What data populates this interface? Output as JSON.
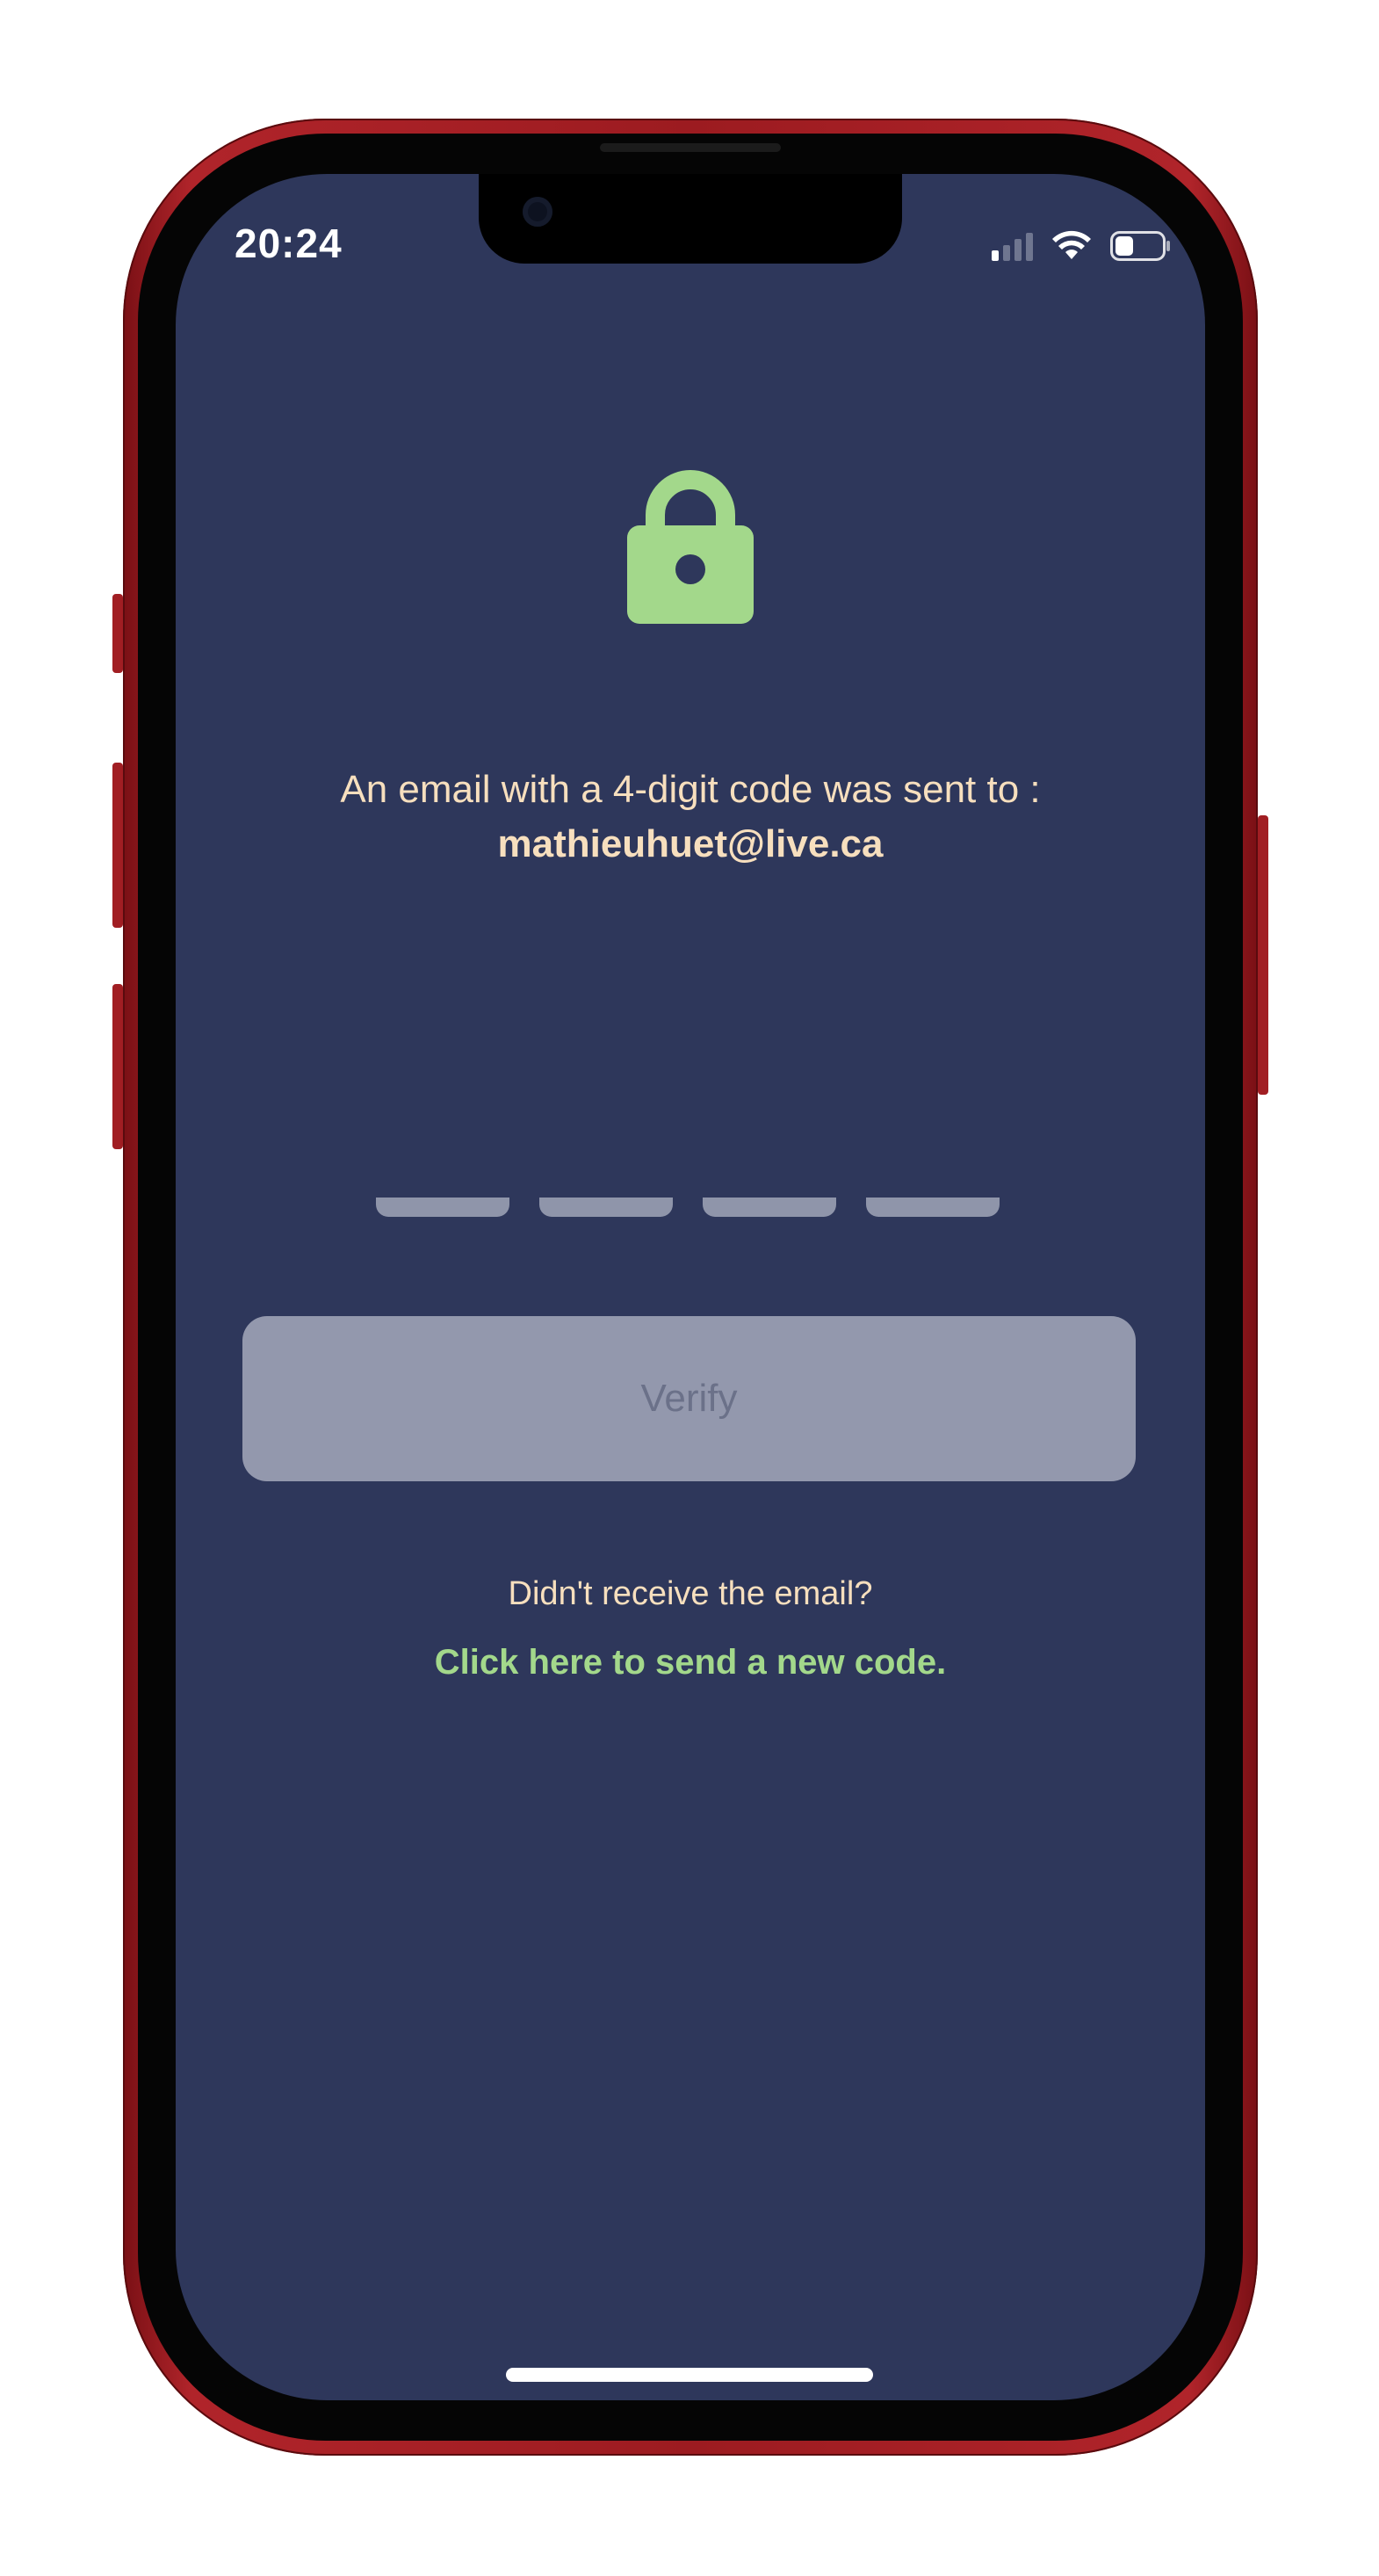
{
  "status_bar": {
    "time": "20:24",
    "signal_icon": "cellular-signal-icon",
    "wifi_icon": "wifi-icon",
    "battery_icon": "battery-icon",
    "battery_level": 0.4
  },
  "verification": {
    "lock_icon": "lock-icon",
    "message": "An email with a 4-digit code was sent to :",
    "email": "mathieuhuet@live.ca",
    "code_digits": [
      "",
      "",
      "",
      ""
    ],
    "verify_label": "Verify",
    "didnt_receive": "Didn't receive the email?",
    "resend_link": "Click here to send a new code."
  },
  "colors": {
    "background": "#2e375b",
    "accent_green": "#a3d88b",
    "text_cream": "#f7dfbe",
    "button_disabled": "#9398ad",
    "phone_frame": "#9c1b20"
  }
}
